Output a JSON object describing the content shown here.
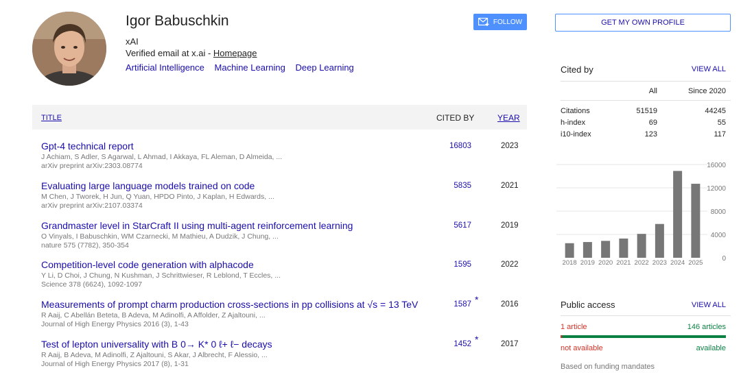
{
  "profile": {
    "name": "Igor Babuschkin",
    "affiliation": "xAI",
    "verified_prefix": "Verified email at x.ai - ",
    "homepage_label": "Homepage",
    "interests": [
      "Artificial Intelligence",
      "Machine Learning",
      "Deep Learning"
    ],
    "follow_label": "FOLLOW"
  },
  "table": {
    "headers": {
      "title": "TITLE",
      "cited_by": "CITED BY",
      "year": "YEAR"
    },
    "rows": [
      {
        "title": "Gpt-4 technical report",
        "authors": "J Achiam, S Adler, S Agarwal, L Ahmad, I Akkaya, FL Aleman, D Almeida, ...",
        "venue": "arXiv preprint arXiv:2303.08774",
        "cited_by": "16803",
        "star": "",
        "year": "2023"
      },
      {
        "title": "Evaluating large language models trained on code",
        "authors": "M Chen, J Tworek, H Jun, Q Yuan, HPDO Pinto, J Kaplan, H Edwards, ...",
        "venue": "arXiv preprint arXiv:2107.03374",
        "cited_by": "5835",
        "star": "",
        "year": "2021"
      },
      {
        "title": "Grandmaster level in StarCraft II using multi-agent reinforcement learning",
        "authors": "O Vinyals, I Babuschkin, WM Czarnecki, M Mathieu, A Dudzik, J Chung, ...",
        "venue": "nature 575 (7782), 350-354",
        "cited_by": "5617",
        "star": "",
        "year": "2019"
      },
      {
        "title": "Competition-level code generation with alphacode",
        "authors": "Y Li, D Choi, J Chung, N Kushman, J Schrittwieser, R Leblond, T Eccles, ...",
        "venue": "Science 378 (6624), 1092-1097",
        "cited_by": "1595",
        "star": "",
        "year": "2022"
      },
      {
        "title": "Measurements of prompt charm production cross-sections in pp collisions at √s = 13 TeV",
        "authors": "R Aaij, C Abellán Beteta, B Adeva, M Adinolfi, A Affolder, Z Ajaltouni, ...",
        "venue": "Journal of High Energy Physics 2016 (3), 1-43",
        "cited_by": "1587",
        "star": "*",
        "year": "2016"
      },
      {
        "title": "Test of lepton universality with B 0→ K* 0 ℓ+ ℓ− decays",
        "authors": "R Aaij, B Adeva, M Adinolfi, Z Ajaltouni, S Akar, J Albrecht, F Alessio, ...",
        "venue": "Journal of High Energy Physics 2017 (8), 1-31",
        "cited_by": "1452",
        "star": "*",
        "year": "2017"
      }
    ]
  },
  "sidebar": {
    "own_profile_label": "GET MY OWN PROFILE",
    "cited_by": {
      "title": "Cited by",
      "view_all": "VIEW ALL",
      "col_all": "All",
      "col_since": "Since 2020",
      "stats": [
        {
          "label": "Citations",
          "all": "51519",
          "since": "44245"
        },
        {
          "label": "h-index",
          "all": "69",
          "since": "55"
        },
        {
          "label": "i10-index",
          "all": "123",
          "since": "117"
        }
      ]
    },
    "public_access": {
      "title": "Public access",
      "view_all": "VIEW ALL",
      "unavailable_count": "1 article",
      "available_count": "146 articles",
      "unavailable_label": "not available",
      "available_label": "available",
      "available_fraction": 0.993,
      "footer": "Based on funding mandates"
    }
  },
  "colors": {
    "link": "#1a0dab",
    "bar": "#777777",
    "follow": "#4d90fe",
    "available": "#0b8043",
    "unavailable": "#d93025"
  },
  "chart_data": {
    "type": "bar",
    "categories": [
      "2018",
      "2019",
      "2020",
      "2021",
      "2022",
      "2023",
      "2024",
      "2025"
    ],
    "values": [
      2500,
      2700,
      2900,
      3300,
      4100,
      5800,
      14900,
      12700
    ],
    "ylim": [
      0,
      16000
    ],
    "y_ticks": [
      "16000",
      "12000",
      "8000",
      "4000",
      "0"
    ],
    "y_tick_values": [
      16000,
      12000,
      8000,
      4000,
      0
    ],
    "grid": true
  }
}
